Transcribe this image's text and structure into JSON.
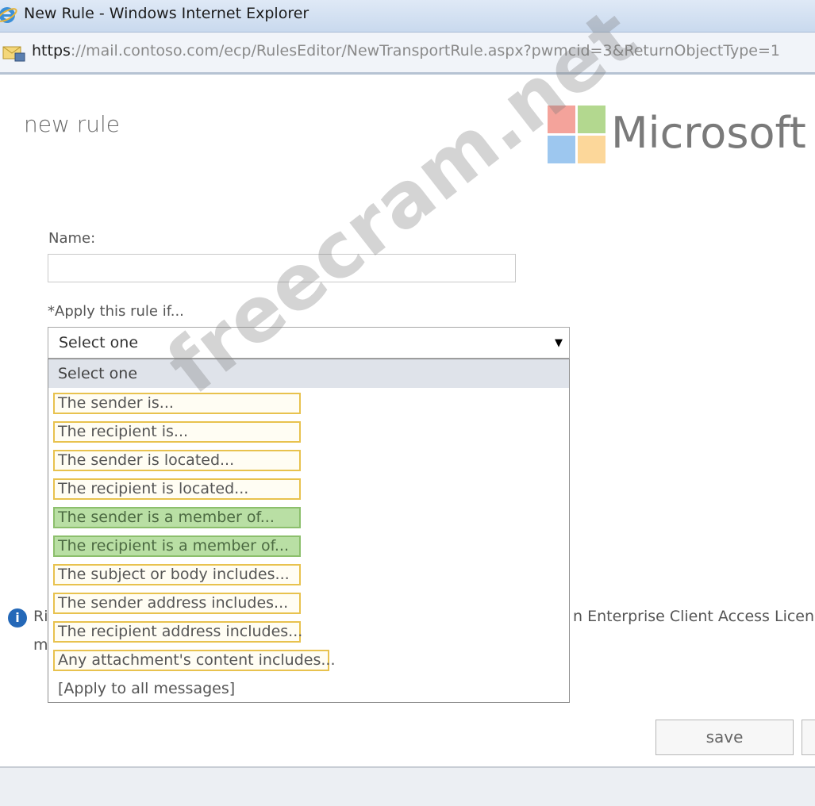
{
  "window": {
    "title": "New Rule - Windows Internet Explorer"
  },
  "address": {
    "protocol": "https",
    "rest": "://mail.contoso.com/ecp/RulesEditor/NewTransportRule.aspx?pwmcid=3&ReturnObjectType=1"
  },
  "page": {
    "title": "new rule"
  },
  "logo": {
    "text": "Microsoft",
    "colors": [
      "#f25022",
      "#7fba00",
      "#00a4ef",
      "#ffb900"
    ]
  },
  "form": {
    "name_label": "Name:",
    "name_value": "",
    "apply_label": "*Apply this rule if...",
    "select_value": "Select one"
  },
  "dropdown": {
    "selected": "Select one",
    "options": [
      "The sender is...",
      "The recipient is...",
      "The sender is located...",
      "The recipient is located...",
      "The sender is a member of...",
      "The recipient is a member of...",
      "The subject or body includes...",
      "The sender address includes...",
      "The recipient address includes...",
      "Any attachment's content includes...",
      "[Apply to all messages]"
    ],
    "highlight_colors": {
      "yellow_border": "#e8c24e",
      "green_fill": "#b9dfa4"
    }
  },
  "info": {
    "left_line1": "Ri",
    "left_line2": "m",
    "right_text": "n Enterprise Client Access Licens"
  },
  "buttons": {
    "save": "save"
  },
  "watermark": "freecram.net"
}
